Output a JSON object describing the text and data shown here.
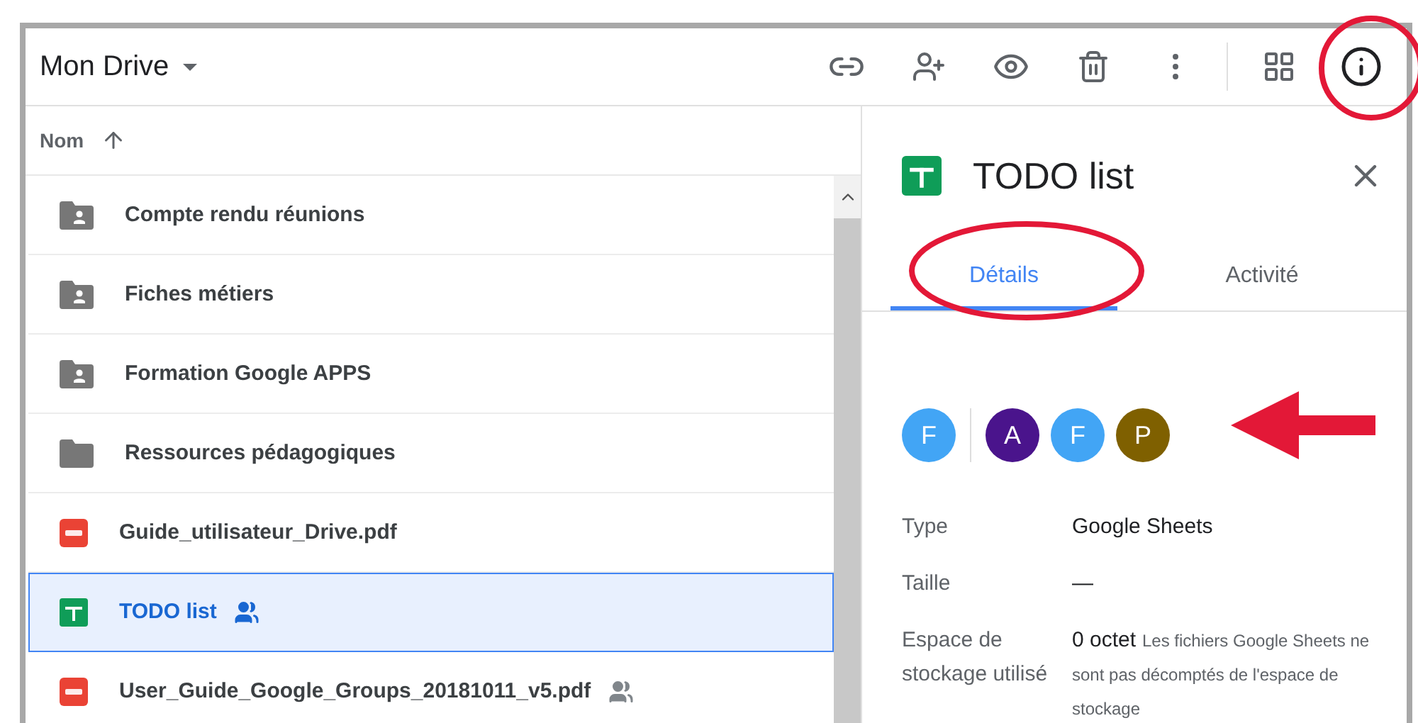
{
  "header": {
    "title": "Mon Drive"
  },
  "list": {
    "column": "Nom",
    "rows": [
      {
        "name": "Compte rendu réunions",
        "kind": "shared-folder",
        "shared": false,
        "selected": false
      },
      {
        "name": "Fiches métiers",
        "kind": "shared-folder",
        "shared": false,
        "selected": false
      },
      {
        "name": "Formation Google APPS",
        "kind": "shared-folder",
        "shared": false,
        "selected": false
      },
      {
        "name": "Ressources pédagogiques",
        "kind": "folder",
        "shared": false,
        "selected": false
      },
      {
        "name": "Guide_utilisateur_Drive.pdf",
        "kind": "pdf",
        "shared": false,
        "selected": false
      },
      {
        "name": "TODO list",
        "kind": "sheet",
        "shared": true,
        "selected": true
      },
      {
        "name": "User_Guide_Google_Groups_20181011_v5.pdf",
        "kind": "pdf",
        "shared": true,
        "selected": false
      }
    ]
  },
  "details": {
    "title": "TODO list",
    "tabs": [
      {
        "label": "Détails",
        "selected": true
      },
      {
        "label": "Activité",
        "selected": false
      }
    ],
    "owner": {
      "letter": "F",
      "color": "#42a5f5"
    },
    "people": [
      {
        "letter": "A",
        "color": "#4a148c"
      },
      {
        "letter": "F",
        "color": "#42a5f5"
      },
      {
        "letter": "P",
        "color": "#7f6000"
      }
    ],
    "fields": [
      {
        "label": "Type",
        "value": "Google Sheets"
      },
      {
        "label": "Taille",
        "value": "—"
      },
      {
        "label": "Espace de stockage utilisé",
        "value": "0 octet",
        "note": "Les fichiers Google Sheets ne sont pas décomptés de l'espace de stockage"
      }
    ]
  }
}
